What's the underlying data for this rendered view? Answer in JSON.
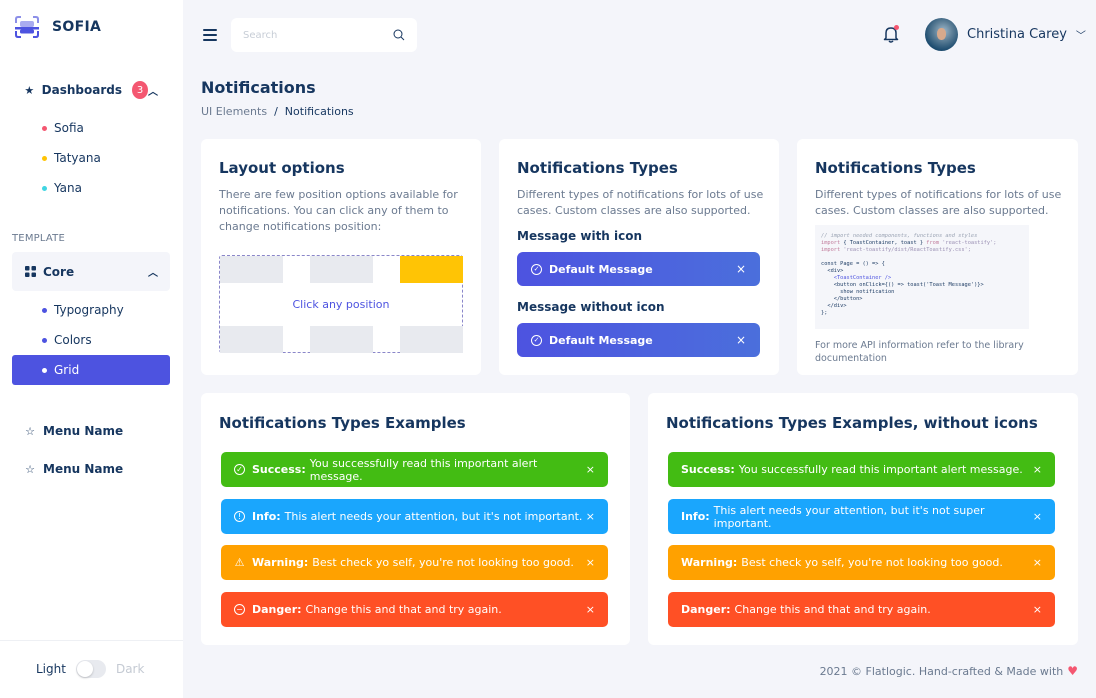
{
  "app": {
    "name": "SOFIA"
  },
  "sidebar": {
    "dashboards": {
      "label": "Dashboards",
      "badge": "3",
      "items": [
        {
          "label": "Sofia",
          "color": "#f45771"
        },
        {
          "label": "Tatyana",
          "color": "#ffc405"
        },
        {
          "label": "Yana",
          "color": "#41d5e2"
        }
      ]
    },
    "section_label": "TEMPLATE",
    "core": {
      "label": "Core",
      "items": [
        {
          "label": "Typography",
          "color": "#4d53e0"
        },
        {
          "label": "Colors",
          "color": "#4d53e0"
        },
        {
          "label": "Grid",
          "color": "#ffffff",
          "active": true
        }
      ]
    },
    "menu_items": [
      {
        "label": "Menu Name"
      },
      {
        "label": "Menu Name"
      }
    ],
    "theme": {
      "light": "Light",
      "dark": "Dark",
      "is_dark": false
    }
  },
  "header": {
    "search_placeholder": "Search",
    "user_name": "Christina Carey",
    "has_notifications": true
  },
  "page": {
    "title": "Notifications",
    "breadcrumb": [
      "UI Elements",
      "Notifications"
    ],
    "separator": "/"
  },
  "layout_card": {
    "title": "Layout options",
    "description": "There are few position options available for notifications. You can click any of them to change notifications position:",
    "prompt": "Click any position",
    "selected_position": "top-right"
  },
  "types_card": {
    "title": "Notifications Types",
    "description": "Different types of notifications for lots of use cases. Custom classes are also supported.",
    "with_icon_label": "Message with icon",
    "without_icon_label": "Message without icon",
    "message": "Default Message",
    "close": "×"
  },
  "code_card": {
    "title": "Notifications Types",
    "description": "Different types of notifications for lots of use cases. Custom classes are also supported.",
    "code_lines": {
      "l1": "// import needed components, functions and styles",
      "l2a": "import",
      "l2b": " { ToastContainer, toast } ",
      "l2c": "from",
      "l2d": " 'react-toastify';",
      "l3a": "import",
      "l3b": " 'react-toastify/dist/ReactToastify.css';",
      "l5": "const Page = () => {",
      "l6": "  <div>",
      "l7": "    <ToastContainer />",
      "l8": "    <button onClick={() => toast('Toast Message')}>",
      "l9": "      show notification",
      "l10": "    </button>",
      "l11": "  </div>",
      "l12": "};"
    },
    "footer_text": "For more API information refer to the library documentation"
  },
  "examples_card": {
    "title": "Notifications Types Examples",
    "alerts": [
      {
        "type": "success",
        "label": "Success:",
        "text": "You successfully read this important alert message."
      },
      {
        "type": "info",
        "label": "Info:",
        "text": "This alert needs your attention, but it's not important."
      },
      {
        "type": "warning",
        "label": "Warning:",
        "text": "Best check yo self, you're not looking too good."
      },
      {
        "type": "danger",
        "label": "Danger:",
        "text": "Change this and that and try again."
      }
    ]
  },
  "examples_noicon_card": {
    "title": "Notifications Types Examples, without icons",
    "alerts": [
      {
        "type": "success",
        "label": "Success:",
        "text": "You successfully read this important alert message."
      },
      {
        "type": "info",
        "label": "Info:",
        "text": "This alert needs your attention, but it's not super important."
      },
      {
        "type": "warning",
        "label": "Warning:",
        "text": "Best check yo self, you're not looking too good."
      },
      {
        "type": "danger",
        "label": "Danger:",
        "text": "Change this and that and try again."
      }
    ]
  },
  "footer": {
    "text": "2021 © Flatlogic. Hand-crafted & Made with",
    "heart": "♥"
  },
  "colors": {
    "primary": "#4d53e0",
    "success": "#43bc13",
    "info": "#1aa6fd",
    "warning": "#ffa100",
    "danger": "#ff5025",
    "text": "#16365f"
  },
  "icons": {
    "close": "×",
    "chevron_up": "⌃",
    "chevron_down": "⌄"
  }
}
